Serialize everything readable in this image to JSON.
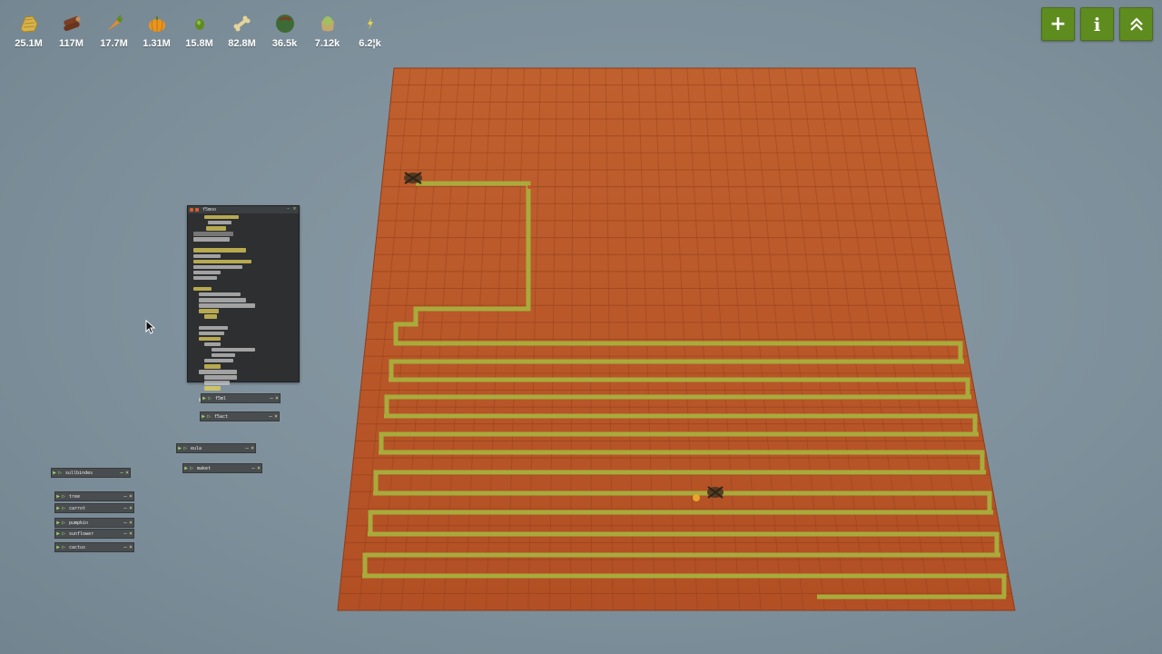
{
  "resources": [
    {
      "icon": "hay-icon",
      "value": "25.1M",
      "color": "#d7b34a"
    },
    {
      "icon": "wood-log-icon",
      "value": "117M",
      "color": "#7a3f22"
    },
    {
      "icon": "carrot-icon",
      "value": "17.7M",
      "color": "#e08c2c"
    },
    {
      "icon": "pumpkin-icon",
      "value": "1.31M",
      "color": "#e8951f"
    },
    {
      "icon": "seed-icon",
      "value": "15.8M",
      "color": "#5f8c1f"
    },
    {
      "icon": "bone-icon",
      "value": "82.8M",
      "color": "#e4d49a"
    },
    {
      "icon": "cactus-ball-icon",
      "value": "36.5k",
      "color": "#3d6b35"
    },
    {
      "icon": "weird-substance-icon",
      "value": "7.12k",
      "color": "#9fc25e"
    },
    {
      "icon": "power-bolt-icon",
      "value": "6.2¦k",
      "color": "#e6d24a"
    }
  ],
  "toolbar": {
    "add_label": "+",
    "info_label": "i",
    "expand_icon": "double-chevron-up-icon",
    "button_color": "#5f8c1f"
  },
  "code_window": {
    "title": "f5moo"
  },
  "script_windows": [
    {
      "name": "f5ml"
    },
    {
      "name": "f5act"
    },
    {
      "name": "eula"
    },
    {
      "name": "maket"
    },
    {
      "name": "sullbindes"
    },
    {
      "name": "tree"
    },
    {
      "name": "carrot"
    },
    {
      "name": "pumpkin"
    },
    {
      "name": "sunflower"
    },
    {
      "name": "cactus"
    }
  ],
  "colors": {
    "background": "#7d8f9a",
    "soil": "#bf5a2b",
    "snake": "#a8ab3c",
    "panel": "#2d2f31"
  }
}
